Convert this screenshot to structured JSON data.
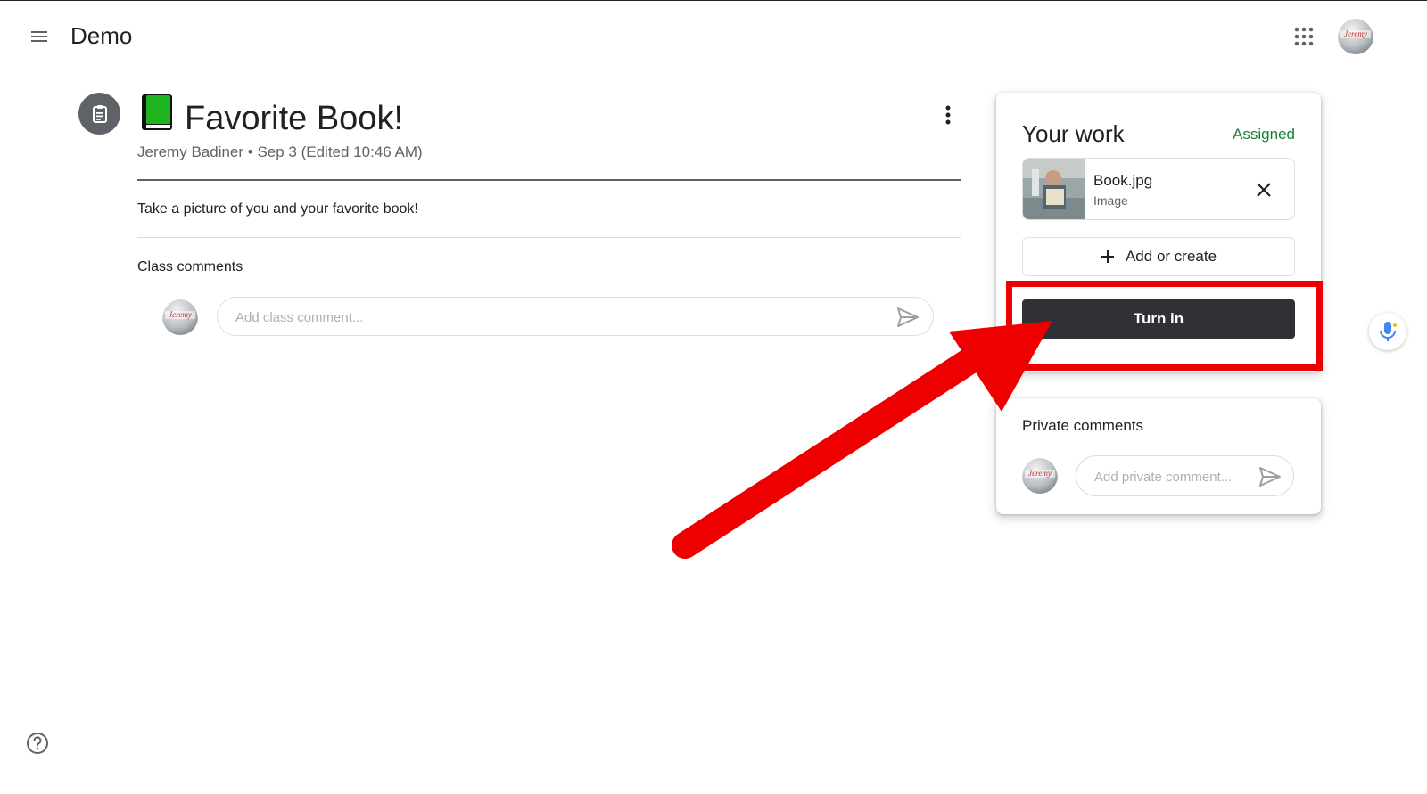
{
  "header": {
    "title": "Demo",
    "menu_icon": "hamburger-menu-icon",
    "apps_icon": "google-apps-grid-icon",
    "avatar_label": "Jeremy"
  },
  "assignment": {
    "icon": "assignment-clipboard-icon",
    "emoji": "📗",
    "title": "Favorite Book!",
    "meta": "Jeremy Badiner • Sep 3 (Edited 10:46 AM)",
    "description": "Take a picture of you and your favorite book!",
    "more_icon": "more-vert-icon"
  },
  "class_comments": {
    "title": "Class comments",
    "placeholder": "Add class comment..."
  },
  "your_work": {
    "title": "Your work",
    "status": "Assigned",
    "attachment": {
      "name": "Book.jpg",
      "type": "Image"
    },
    "add_or_create": "Add or create",
    "turn_in": "Turn in"
  },
  "private_comments": {
    "title": "Private comments",
    "placeholder": "Add private comment..."
  },
  "colors": {
    "accent_green": "#188038",
    "turn_in_bg": "#303134",
    "annotation_red": "#ee0000",
    "book_green": "#1db41d"
  }
}
